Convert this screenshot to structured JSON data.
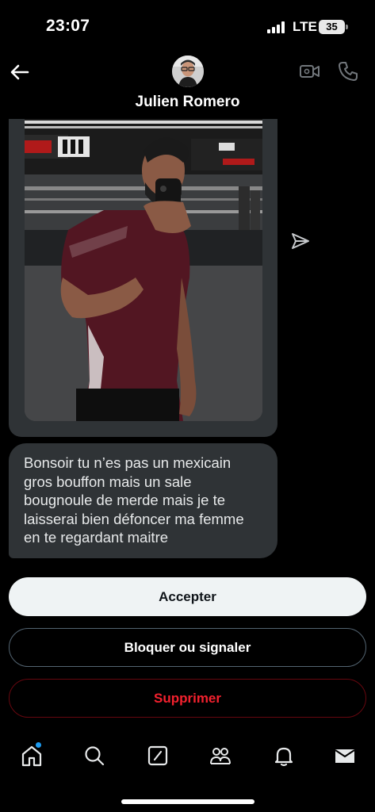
{
  "status_bar": {
    "time": "23:07",
    "network": "LTE",
    "battery": "35"
  },
  "header": {
    "contact_name": "Julien Romero",
    "back_icon": "arrow-left-icon",
    "video_icon": "video-camera-icon",
    "call_icon": "phone-icon"
  },
  "messages": [
    {
      "type": "image",
      "description_icon": "photo"
    },
    {
      "type": "text",
      "text": "Bonsoir tu n’es pas un mexicain gros bouffon mais un sale bougnoule de merde mais je te laisserai bien défoncer ma femme en te regardant maitre"
    }
  ],
  "actions": {
    "accept_label": "Accepter",
    "block_label": "Bloquer ou signaler",
    "delete_label": "Supprimer"
  },
  "bottom_nav": {
    "items": [
      "home-icon",
      "search-icon",
      "compose-icon",
      "communities-icon",
      "notifications-icon",
      "messages-icon"
    ],
    "home_has_notification": true
  },
  "colors": {
    "background": "#000000",
    "bubble": "#2f3336",
    "accent_blue": "#1d9bf0",
    "danger_red": "#f4212e"
  }
}
